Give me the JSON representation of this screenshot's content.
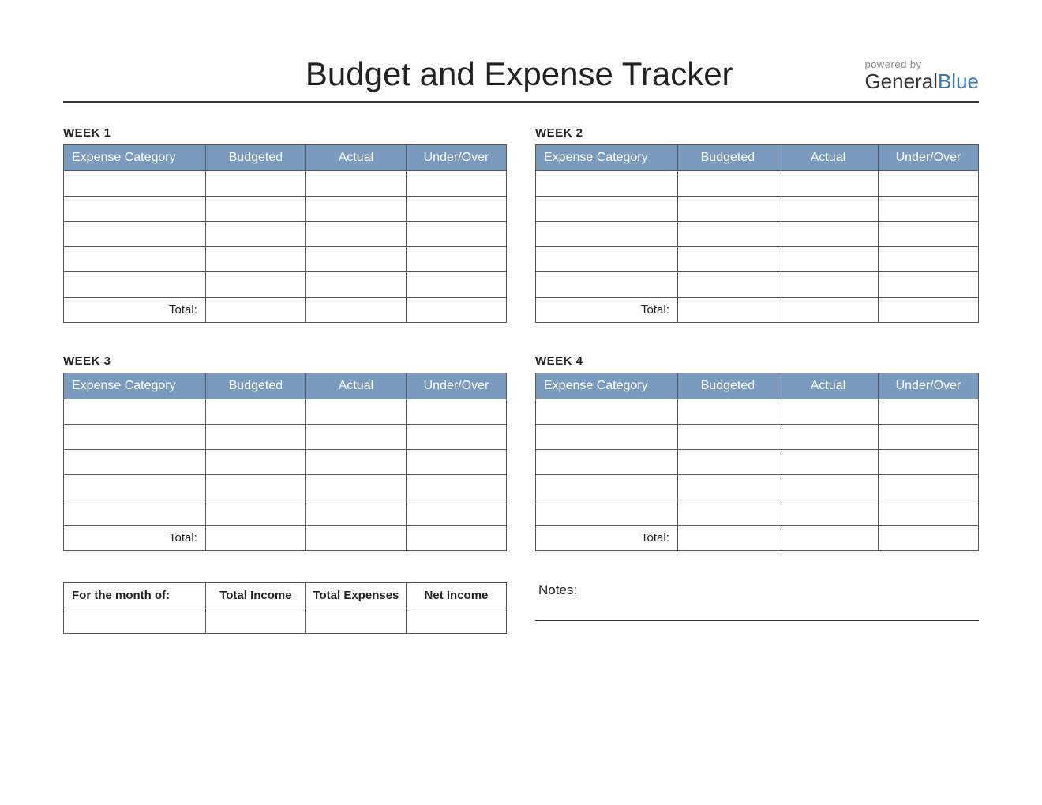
{
  "header": {
    "title": "Budget and Expense Tracker",
    "powered_by": "powered by",
    "brand_general": "General",
    "brand_blue": "Blue"
  },
  "columns": {
    "category": "Expense Category",
    "budgeted": "Budgeted",
    "actual": "Actual",
    "under_over": "Under/Over"
  },
  "weeks": [
    {
      "label": "WEEK 1",
      "total_label": "Total:"
    },
    {
      "label": "WEEK 2",
      "total_label": "Total:"
    },
    {
      "label": "WEEK 3",
      "total_label": "Total:"
    },
    {
      "label": "WEEK 4",
      "total_label": "Total:"
    }
  ],
  "summary": {
    "month_label": "For the month of:",
    "total_income": "Total Income",
    "total_expenses": "Total Expenses",
    "net_income": "Net Income"
  },
  "notes": {
    "label": "Notes:"
  }
}
